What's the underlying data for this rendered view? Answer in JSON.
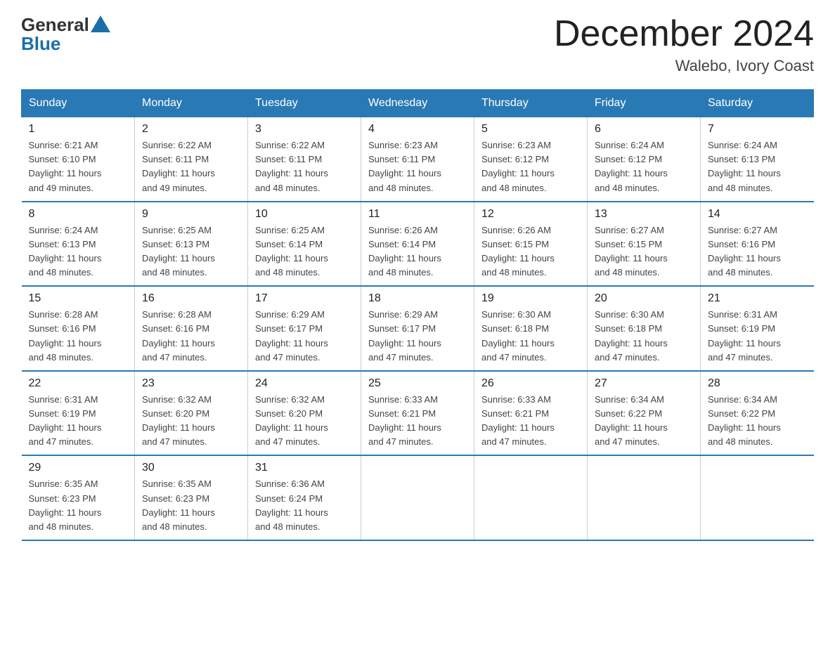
{
  "header": {
    "logo_general": "General",
    "logo_blue": "Blue",
    "title": "December 2024",
    "subtitle": "Walebo, Ivory Coast"
  },
  "columns": [
    "Sunday",
    "Monday",
    "Tuesday",
    "Wednesday",
    "Thursday",
    "Friday",
    "Saturday"
  ],
  "weeks": [
    [
      {
        "day": "1",
        "info": "Sunrise: 6:21 AM\nSunset: 6:10 PM\nDaylight: 11 hours\nand 49 minutes."
      },
      {
        "day": "2",
        "info": "Sunrise: 6:22 AM\nSunset: 6:11 PM\nDaylight: 11 hours\nand 49 minutes."
      },
      {
        "day": "3",
        "info": "Sunrise: 6:22 AM\nSunset: 6:11 PM\nDaylight: 11 hours\nand 48 minutes."
      },
      {
        "day": "4",
        "info": "Sunrise: 6:23 AM\nSunset: 6:11 PM\nDaylight: 11 hours\nand 48 minutes."
      },
      {
        "day": "5",
        "info": "Sunrise: 6:23 AM\nSunset: 6:12 PM\nDaylight: 11 hours\nand 48 minutes."
      },
      {
        "day": "6",
        "info": "Sunrise: 6:24 AM\nSunset: 6:12 PM\nDaylight: 11 hours\nand 48 minutes."
      },
      {
        "day": "7",
        "info": "Sunrise: 6:24 AM\nSunset: 6:13 PM\nDaylight: 11 hours\nand 48 minutes."
      }
    ],
    [
      {
        "day": "8",
        "info": "Sunrise: 6:24 AM\nSunset: 6:13 PM\nDaylight: 11 hours\nand 48 minutes."
      },
      {
        "day": "9",
        "info": "Sunrise: 6:25 AM\nSunset: 6:13 PM\nDaylight: 11 hours\nand 48 minutes."
      },
      {
        "day": "10",
        "info": "Sunrise: 6:25 AM\nSunset: 6:14 PM\nDaylight: 11 hours\nand 48 minutes."
      },
      {
        "day": "11",
        "info": "Sunrise: 6:26 AM\nSunset: 6:14 PM\nDaylight: 11 hours\nand 48 minutes."
      },
      {
        "day": "12",
        "info": "Sunrise: 6:26 AM\nSunset: 6:15 PM\nDaylight: 11 hours\nand 48 minutes."
      },
      {
        "day": "13",
        "info": "Sunrise: 6:27 AM\nSunset: 6:15 PM\nDaylight: 11 hours\nand 48 minutes."
      },
      {
        "day": "14",
        "info": "Sunrise: 6:27 AM\nSunset: 6:16 PM\nDaylight: 11 hours\nand 48 minutes."
      }
    ],
    [
      {
        "day": "15",
        "info": "Sunrise: 6:28 AM\nSunset: 6:16 PM\nDaylight: 11 hours\nand 48 minutes."
      },
      {
        "day": "16",
        "info": "Sunrise: 6:28 AM\nSunset: 6:16 PM\nDaylight: 11 hours\nand 47 minutes."
      },
      {
        "day": "17",
        "info": "Sunrise: 6:29 AM\nSunset: 6:17 PM\nDaylight: 11 hours\nand 47 minutes."
      },
      {
        "day": "18",
        "info": "Sunrise: 6:29 AM\nSunset: 6:17 PM\nDaylight: 11 hours\nand 47 minutes."
      },
      {
        "day": "19",
        "info": "Sunrise: 6:30 AM\nSunset: 6:18 PM\nDaylight: 11 hours\nand 47 minutes."
      },
      {
        "day": "20",
        "info": "Sunrise: 6:30 AM\nSunset: 6:18 PM\nDaylight: 11 hours\nand 47 minutes."
      },
      {
        "day": "21",
        "info": "Sunrise: 6:31 AM\nSunset: 6:19 PM\nDaylight: 11 hours\nand 47 minutes."
      }
    ],
    [
      {
        "day": "22",
        "info": "Sunrise: 6:31 AM\nSunset: 6:19 PM\nDaylight: 11 hours\nand 47 minutes."
      },
      {
        "day": "23",
        "info": "Sunrise: 6:32 AM\nSunset: 6:20 PM\nDaylight: 11 hours\nand 47 minutes."
      },
      {
        "day": "24",
        "info": "Sunrise: 6:32 AM\nSunset: 6:20 PM\nDaylight: 11 hours\nand 47 minutes."
      },
      {
        "day": "25",
        "info": "Sunrise: 6:33 AM\nSunset: 6:21 PM\nDaylight: 11 hours\nand 47 minutes."
      },
      {
        "day": "26",
        "info": "Sunrise: 6:33 AM\nSunset: 6:21 PM\nDaylight: 11 hours\nand 47 minutes."
      },
      {
        "day": "27",
        "info": "Sunrise: 6:34 AM\nSunset: 6:22 PM\nDaylight: 11 hours\nand 47 minutes."
      },
      {
        "day": "28",
        "info": "Sunrise: 6:34 AM\nSunset: 6:22 PM\nDaylight: 11 hours\nand 48 minutes."
      }
    ],
    [
      {
        "day": "29",
        "info": "Sunrise: 6:35 AM\nSunset: 6:23 PM\nDaylight: 11 hours\nand 48 minutes."
      },
      {
        "day": "30",
        "info": "Sunrise: 6:35 AM\nSunset: 6:23 PM\nDaylight: 11 hours\nand 48 minutes."
      },
      {
        "day": "31",
        "info": "Sunrise: 6:36 AM\nSunset: 6:24 PM\nDaylight: 11 hours\nand 48 minutes."
      },
      null,
      null,
      null,
      null
    ]
  ]
}
